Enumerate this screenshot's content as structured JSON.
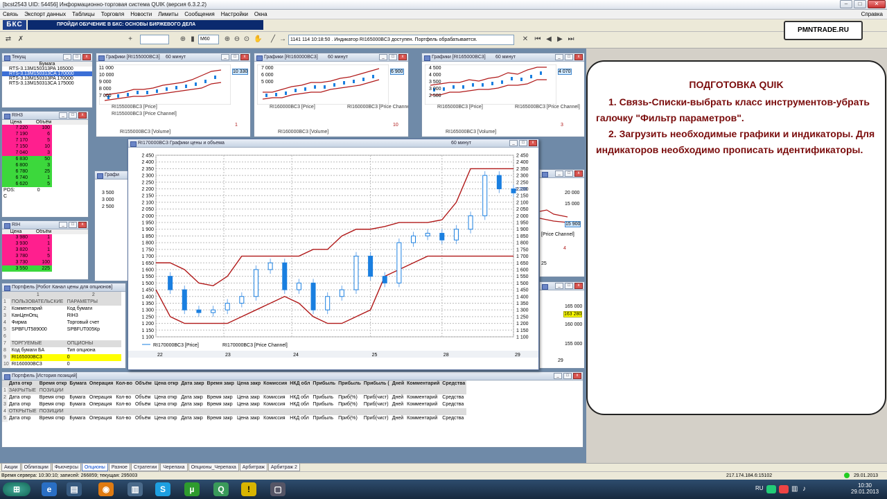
{
  "window": {
    "title": "[bcst2543 UID: 54456] Информационно-торговая система QUIK (версия 6.3.2.2)"
  },
  "menu": [
    "Связь",
    "Экспорт данных",
    "Таблицы",
    "Торговля",
    "Новости",
    "Лимиты",
    "Сообщения",
    "Настройки",
    "Окна"
  ],
  "menu_right": "Справка",
  "brand": {
    "logo": "БКС",
    "promo": "ПРОЙДИ ОБУЧЕНИЕ В БКС: ОСНОВЫ БИРЖЕВОГО ДЕЛА",
    "pmn": "PMNTRADE.RU"
  },
  "toolbar": {
    "interval": "M60",
    "msg_counter": "1141 114",
    "message": "10:18:50 . Индикатор RI165000BC3 доступен. Портфель обрабатывается."
  },
  "current_table": {
    "title": "Текущ",
    "header": "Бумага",
    "rows": [
      "RTS-3.13M150313PA 165000",
      "RTS-3.13M150313CA 170000",
      "RTS-3.13M150313PA 170000",
      "RTS-3.13M150313CA 175000"
    ]
  },
  "glass1": {
    "title": "RIH3",
    "h_price": "Цена",
    "h_vol": "Объём",
    "sell": [
      [
        "7 220",
        "100"
      ],
      [
        "7 190",
        "6"
      ],
      [
        "7 170",
        "5"
      ],
      [
        "7 150",
        "10"
      ],
      [
        "7 040",
        "3"
      ]
    ],
    "buy": [
      [
        "6 830",
        "50"
      ],
      [
        "6 800",
        "3"
      ],
      [
        "6 780",
        "25"
      ],
      [
        "6 740",
        "1"
      ],
      [
        "6 620",
        "5"
      ]
    ],
    "pos_label": "POS",
    "pos_val": "0",
    "c_label": "C"
  },
  "glass2": {
    "title": "RIH",
    "h_price": "Цена",
    "h_vol": "Объём",
    "sell": [
      [
        "3 980",
        "1"
      ],
      [
        "3 930",
        "1"
      ],
      [
        "3 820",
        "1"
      ],
      [
        "3 780",
        "5"
      ],
      [
        "3 730",
        "100"
      ]
    ],
    "buy": [
      [
        "3 550",
        "225"
      ]
    ]
  },
  "small_charts": [
    {
      "title": "Графики [RI155000BC3]",
      "tf": "60 минут",
      "price": "RI155000BC3 [Price]",
      "chan": "RI155000BC3 [Price Channel]",
      "volume": "RI155000BC3 [Volume]",
      "ticks": [
        "11 000",
        "10 000",
        "9 000",
        "8 000",
        "7 000"
      ],
      "last": "10 330",
      "vcount": "1"
    },
    {
      "title": "Графики [RI160000BC3]",
      "tf": "60 минут",
      "price": "RI160000BC3 [Price]",
      "chan": "RI160000BC3 [Price Channel]",
      "volume": "RI160000BC3 [Volume]",
      "ticks": [
        "7 000",
        "6 000",
        "5 000"
      ],
      "last": "6 900",
      "vcount": "10"
    },
    {
      "title": "Графики [RI165000BC3]",
      "tf": "60 минут",
      "price": "RI165000BC3 [Price]",
      "chan": "RI165000BC3 [Price Channel]",
      "volume": "RI165000BC3 [Volume]",
      "ticks": [
        "4 500",
        "4 000",
        "3 500",
        "3 000",
        "2 500"
      ],
      "last": "4 070",
      "vcount": "3"
    }
  ],
  "hidden_chart": {
    "ticks": [
      "3 500",
      "3 000",
      "2 500"
    ]
  },
  "right_chart1": {
    "ticks": [
      "20 000",
      "15 000"
    ],
    "last": "15 900",
    "chan": "[Price Channel]",
    "vcount": "4",
    "tick_b": "25"
  },
  "right_chart2": {
    "ticks": [
      "165 000",
      "160 000",
      "155 000"
    ],
    "last": "163 280",
    "tick_b": "29"
  },
  "main_chart": {
    "title": "RI170000BC3 Графики цены и объема",
    "tf": "60 минут",
    "legend_price": "RI170000BC3 [Price]",
    "legend_chan": "RI170000BC3 [Price Channel]",
    "yticks": [
      "2 450",
      "2 400",
      "2 350",
      "2 300",
      "2 250",
      "2 200",
      "2 150",
      "2 100",
      "2 050",
      "2 000",
      "1 950",
      "1 900",
      "1 850",
      "1 800",
      "1 750",
      "1 700",
      "1 650",
      "1 600",
      "1 550",
      "1 500",
      "1 450",
      "1 400",
      "1 350",
      "1 300",
      "1 250",
      "1 200",
      "1 150",
      "1 100"
    ],
    "last": "2 200",
    "xticks": [
      "22",
      "23",
      "24",
      "25",
      "28",
      "29"
    ]
  },
  "chart_data": {
    "type": "line",
    "title": "RI170000BC3 Графики цены и объема",
    "xlabel": "",
    "ylabel": "",
    "ylim": [
      1100,
      2450
    ],
    "x": [
      0,
      4,
      8,
      12,
      16,
      20,
      24,
      28,
      32,
      36,
      40,
      44,
      48,
      52,
      56,
      60,
      64,
      68,
      72,
      76,
      80,
      84,
      88,
      92,
      96,
      100
    ],
    "series": [
      {
        "name": "RI170000BC3 [Price]",
        "values": [
          1550,
          1450,
          1300,
          1280,
          1300,
          1350,
          1400,
          1600,
          1650,
          1450,
          1500,
          1300,
          1400,
          1450,
          1700,
          1550,
          1500,
          1800,
          1850,
          1870,
          1820,
          1900,
          2000,
          2300,
          2200,
          2170
        ]
      },
      {
        "name": "RI170000BC3 [Price Channel]",
        "values": [
          1650,
          1650,
          1600,
          1500,
          1480,
          1550,
          1700,
          1700,
          1700,
          1700,
          1700,
          1750,
          1750,
          1850,
          1900,
          1900,
          1920,
          1950,
          1950,
          1950,
          1970,
          2100,
          2350,
          2350,
          2350,
          2350
        ]
      },
      {
        "name": "RI170000BC3 [Price Channel]",
        "values": [
          1450,
          1250,
          1200,
          1200,
          1200,
          1200,
          1250,
          1300,
          1350,
          1400,
          1350,
          1250,
          1200,
          1200,
          1250,
          1300,
          1550,
          1600,
          1650,
          1700,
          1700,
          1700,
          1700,
          1700,
          1700,
          1700
        ]
      }
    ]
  },
  "portfolio": {
    "title": "Портфель [Робот Канал цены для опционов]",
    "cols": [
      "1",
      "2"
    ],
    "rows": [
      {
        "n": "1",
        "a": "ПОЛЬЗОВАТЕЛЬСКИЕ",
        "b": "ПАРАМЕТРЫ",
        "type": "hdr"
      },
      {
        "n": "2",
        "a": "Комментарий",
        "b": "Код бумаги",
        "type": ""
      },
      {
        "n": "3",
        "a": "КанЦенОпц",
        "b": "RIH3",
        "type": ""
      },
      {
        "n": "4",
        "a": "Фирма",
        "b": "Торговый счет",
        "type": ""
      },
      {
        "n": "5",
        "a": "SPBFUT589000",
        "b": "SPBFUT005Кр",
        "type": ""
      },
      {
        "n": "6",
        "a": "",
        "b": "",
        "type": ""
      },
      {
        "n": "7",
        "a": "ТОРГУЕМЫЕ",
        "b": "ОПЦИОНЫ",
        "type": "hdr"
      },
      {
        "n": "8",
        "a": "Код бумаги БА",
        "b": "Тип опциона",
        "type": ""
      },
      {
        "n": "9",
        "a": "RI165000BC3",
        "b": "0",
        "type": "hl"
      },
      {
        "n": "10",
        "a": "RI160000BC3",
        "b": "0",
        "type": ""
      }
    ]
  },
  "history": {
    "title": "Портфель [История позиций]",
    "cols": [
      "Дата откр",
      "Время откр",
      "Бумага",
      "Операция",
      "Кол-во",
      "Объём",
      "Цена откр",
      "Дата закр",
      "Время закр",
      "Цена закр",
      "Комиссия",
      "НКД обл",
      "Прибыль",
      "Прибыль",
      "Прибыль (",
      "Дней",
      "Комментарий",
      "Средства"
    ],
    "closed_label": [
      "ЗАКРЫТЫЕ",
      "ПОЗИЦИИ"
    ],
    "open_label": [
      "ОТКРЫТЫЕ",
      "ПОЗИЦИИ"
    ],
    "row": [
      "Дата откр",
      "Время откр",
      "Бумага",
      "Операция",
      "Кол-во",
      "Объём",
      "Цена откр",
      "Дата закр",
      "Время закр",
      "Цена закр",
      "Комиссия",
      "НКД обл",
      "Прибыль",
      "Приб(%)",
      "Приб(чист)",
      "Дней",
      "Комментарий",
      "Средства"
    ]
  },
  "tabs": [
    "Акции",
    "Облигации",
    "Фьючерсы",
    "Опционы",
    "Разное",
    "Стратегии",
    "Черепаха",
    "Опционы_Черепаха",
    "Арбитраж",
    "Арбитраж 2"
  ],
  "active_tab": "Опционы",
  "status": {
    "left": "Время сервера: 10:30:10; записей: 266859; текущая: 295003",
    "ip": "217.174.184.6:15102",
    "date": "29.01.2013"
  },
  "tray": {
    "lang": "RU",
    "time": "10:30",
    "date": "29.01.2013"
  },
  "note": {
    "title": "ПОДГОТОВКА QUIK",
    "p1": "1. Связь-Списки-выбрать класс инструментов-убрать галочку \"Фильтр параметров\".",
    "p2": "2. Загрузить необходимые графики и индикаторы. Для индикаторов необходимо прописать идентификаторы."
  },
  "colors": {
    "sell": "#ff1f8e",
    "buy": "#3cd83c",
    "channel": "#b01818",
    "candle": "#1a7fe0",
    "note_text": "#7a0c0c",
    "highlight": "#ffff00"
  }
}
